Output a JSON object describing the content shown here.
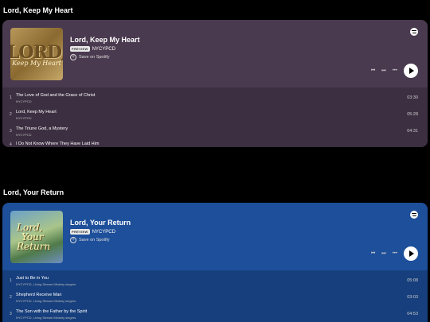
{
  "sections": [
    {
      "heading": "Lord, Keep My Heart",
      "art": {
        "big": "LORD,",
        "small": "Keep My Heart"
      },
      "title": "Lord, Keep My Heart",
      "badge": "PREVIEW",
      "artist": "NYCYPCD",
      "save_label": "Save on Spotify",
      "tracks": [
        {
          "num": "1",
          "name": "The Love of God and the Grace of Christ",
          "artist": "NYCYPCD",
          "duration": "03:30"
        },
        {
          "num": "2",
          "name": "Lord, Keep My Heart",
          "artist": "NYCYPCD",
          "duration": "05:28"
        },
        {
          "num": "3",
          "name": "The Triune God, a Mystery",
          "artist": "NYCYPCD",
          "duration": "04:31"
        },
        {
          "num": "4",
          "name": "I Do Not Know Where They Have Laid Him",
          "artist": "",
          "duration": ""
        }
      ]
    },
    {
      "heading": "Lord, Your Return",
      "art": {
        "line1": "Lord,",
        "line2": "Your",
        "line3": "Return"
      },
      "title": "Lord, Your Return",
      "badge": "PREVIEW",
      "artist": "NYCYPCD",
      "save_label": "Save on Spotify",
      "tracks": [
        {
          "num": "1",
          "name": "Just to Be in You",
          "artist": "NYCYPCD, Living Stream Ministry singers",
          "duration": "05:08"
        },
        {
          "num": "2",
          "name": "Shepherd Receive Man",
          "artist": "NYCYPCD, Living Stream Ministry singers",
          "duration": "03:03"
        },
        {
          "num": "3",
          "name": "The Son with the Father by the Spirit",
          "artist": "NYCYPCD, Living Stream Ministry singers",
          "duration": "04:53"
        }
      ]
    }
  ],
  "colors": {
    "purple_embed": "#4a3a4f",
    "blue_embed": "#1d4f9a"
  }
}
